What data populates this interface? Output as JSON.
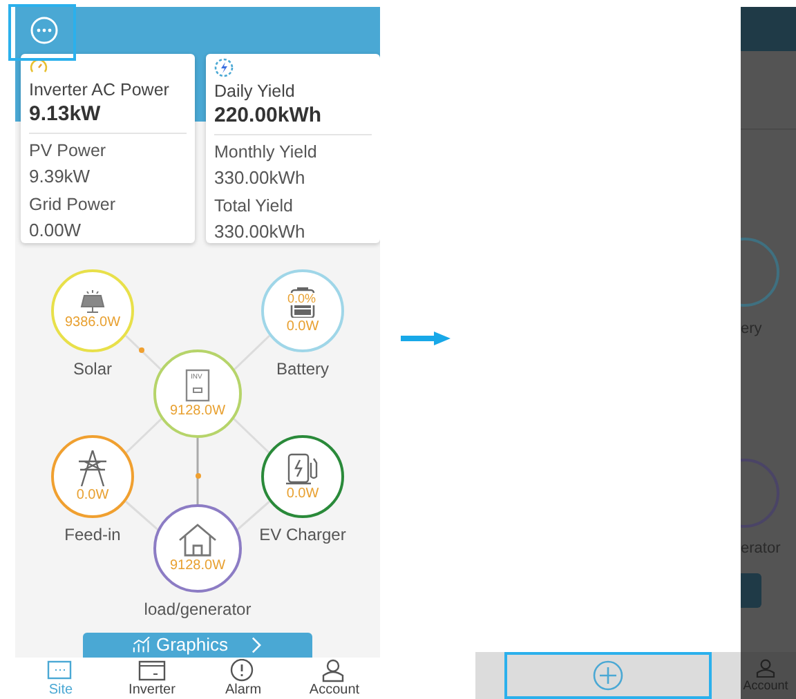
{
  "summary_cards": [
    {
      "kind": "gauge",
      "title": "Inverter AC Power",
      "value": "9.13kW",
      "rows": [
        {
          "label": "PV Power",
          "value": "9.39kW"
        },
        {
          "label": "Grid Power",
          "value": "0.00W"
        }
      ]
    },
    {
      "kind": "bolt",
      "title": "Daily Yield",
      "value": "220.00kWh",
      "rows": [
        {
          "label": "Monthly Yield",
          "value": "330.00kWh"
        },
        {
          "label": "Total Yield",
          "value": "330.00kWh"
        }
      ]
    }
  ],
  "flow_nodes": [
    {
      "kind": "solar",
      "label": "Solar",
      "reading": "9386.0W",
      "color": "#e8e04a"
    },
    {
      "kind": "battery",
      "label": "Battery",
      "percent": "0.0%",
      "reading": "0.0W",
      "color": "#9fd6e8"
    },
    {
      "kind": "inverter",
      "badge": "INV",
      "reading": "9128.0W",
      "color": "#b6d46a"
    },
    {
      "kind": "grid",
      "label": "Feed-in",
      "reading": "0.0W",
      "color": "#f0a030"
    },
    {
      "kind": "ev",
      "label": "EV Charger",
      "reading": "0.0W",
      "color": "#2a8a3a"
    },
    {
      "kind": "load",
      "label": "load/generator",
      "reading": "9128.0W",
      "color": "#8c7cc4"
    }
  ],
  "graphics_button": {
    "label": "Graphics"
  },
  "tabs": [
    {
      "kind": "site",
      "label": "Site",
      "selected": true
    },
    {
      "kind": "inverter",
      "label": "Inverter",
      "selected": false
    },
    {
      "kind": "alarm",
      "label": "Alarm",
      "selected": false
    },
    {
      "kind": "account",
      "label": "Account",
      "selected": false
    }
  ],
  "dimmed_page": {
    "labels": [
      "ery",
      "erator"
    ],
    "tab": "Account"
  }
}
